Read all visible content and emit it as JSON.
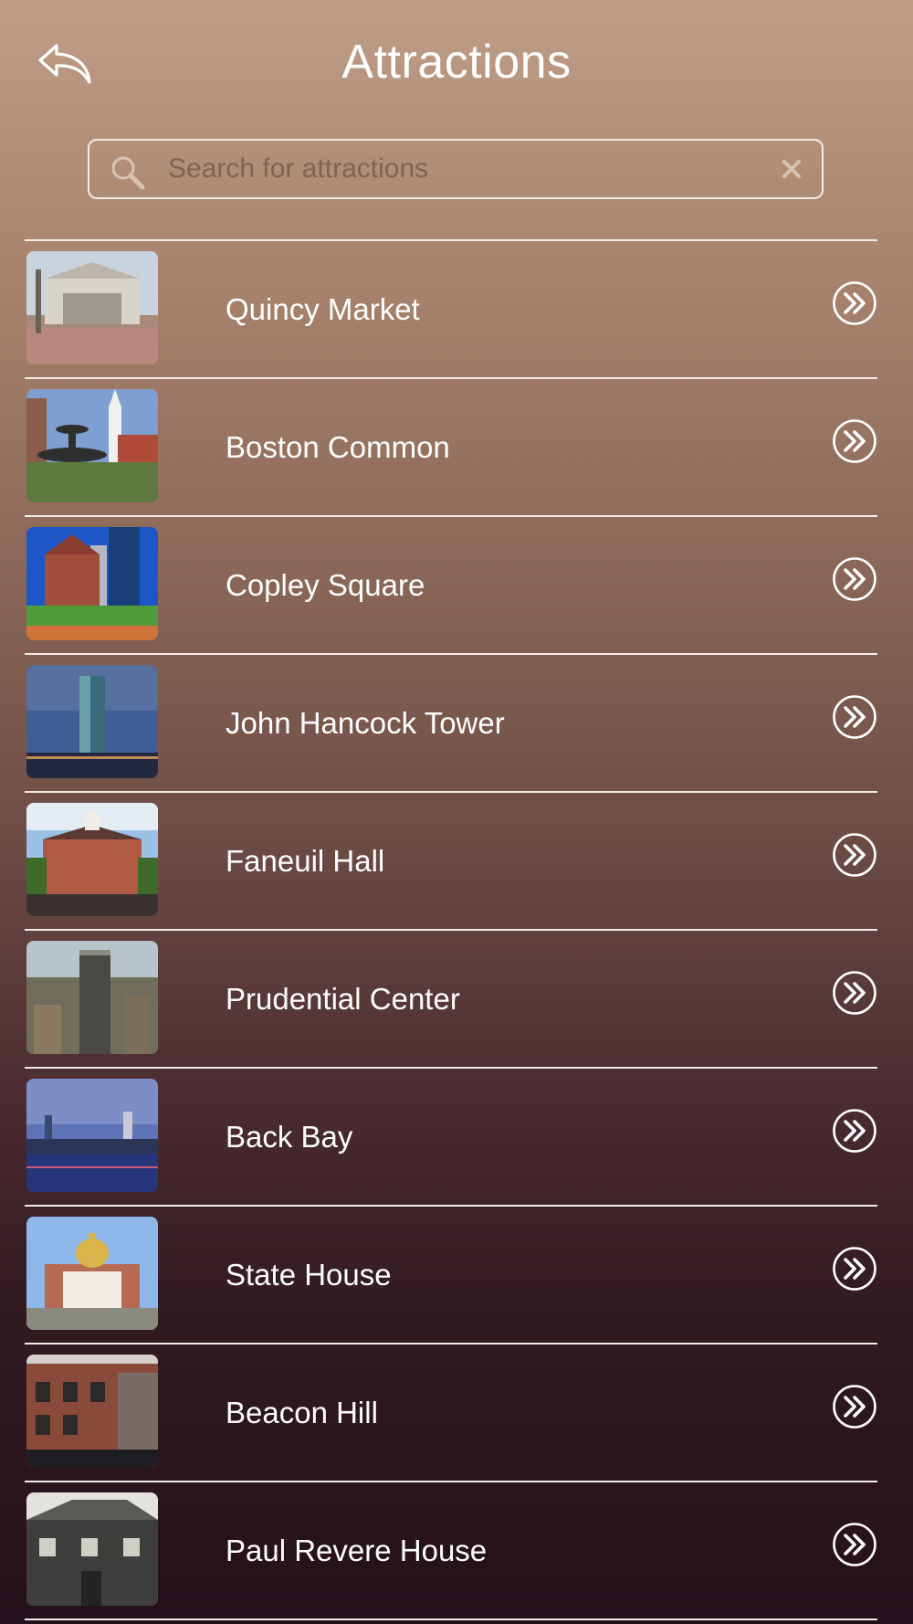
{
  "header": {
    "title": "Attractions",
    "back_icon": "back-arrow-icon"
  },
  "search": {
    "placeholder": "Search for attractions",
    "value": "",
    "search_icon": "search-icon",
    "clear_icon": "close-icon"
  },
  "attractions": [
    {
      "label": "Quincy Market",
      "thumbnail": "quincy-market-photo",
      "arrow_icon": "double-chevron-right-icon"
    },
    {
      "label": "Boston Common",
      "thumbnail": "boston-common-photo",
      "arrow_icon": "double-chevron-right-icon"
    },
    {
      "label": "Copley Square",
      "thumbnail": "copley-square-photo",
      "arrow_icon": "double-chevron-right-icon"
    },
    {
      "label": "John Hancock Tower",
      "thumbnail": "john-hancock-tower-photo",
      "arrow_icon": "double-chevron-right-icon"
    },
    {
      "label": "Faneuil Hall",
      "thumbnail": "faneuil-hall-photo",
      "arrow_icon": "double-chevron-right-icon"
    },
    {
      "label": "Prudential Center",
      "thumbnail": "prudential-center-photo",
      "arrow_icon": "double-chevron-right-icon"
    },
    {
      "label": "Back Bay",
      "thumbnail": "back-bay-photo",
      "arrow_icon": "double-chevron-right-icon"
    },
    {
      "label": "State House",
      "thumbnail": "state-house-photo",
      "arrow_icon": "double-chevron-right-icon"
    },
    {
      "label": "Beacon Hill",
      "thumbnail": "beacon-hill-photo",
      "arrow_icon": "double-chevron-right-icon"
    },
    {
      "label": "Paul Revere House",
      "thumbnail": "paul-revere-house-photo",
      "arrow_icon": "double-chevron-right-icon"
    }
  ],
  "colors": {
    "background_top": "#bf9d86",
    "background_bottom": "#24101a",
    "text": "#ffffff",
    "divider": "#f4ece6"
  }
}
